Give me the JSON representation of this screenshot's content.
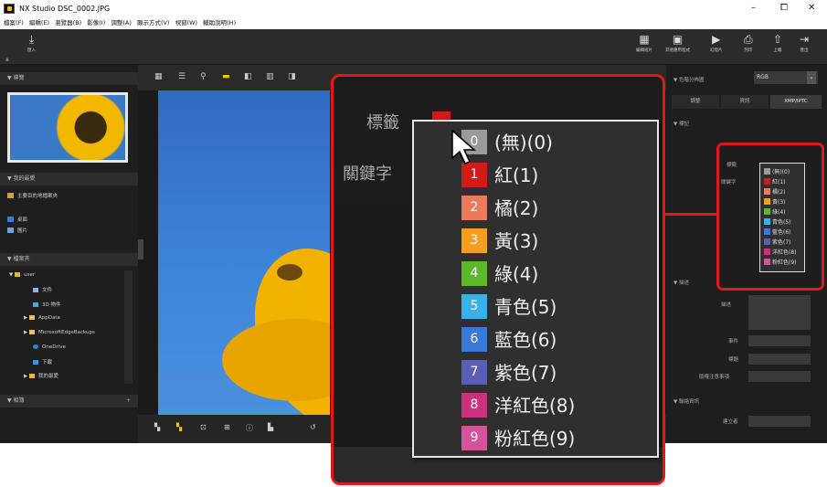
{
  "window": {
    "title": "NX Studio   DSC_0002.JPG",
    "controls": [
      "–",
      "⧠",
      "✕"
    ]
  },
  "menu": [
    "檔案(F)",
    "編輯(E)",
    "瀏覽器(B)",
    "影像(I)",
    "調整(A)",
    "顯示方式(V)",
    "視窗(W)",
    "輔助說明(H)"
  ],
  "toolbar": {
    "import": "匯入",
    "right": [
      {
        "icon": "edit-movie-icon",
        "label": "編輯短片"
      },
      {
        "icon": "other-app-icon",
        "label": "其他應用程式"
      },
      {
        "icon": "slideshow-icon",
        "label": "幻燈片"
      },
      {
        "icon": "print-icon",
        "label": "列印"
      },
      {
        "icon": "upload-icon",
        "label": "上載"
      },
      {
        "icon": "export-icon",
        "label": "匯出"
      }
    ]
  },
  "left": {
    "navigator": "導覽",
    "favorites": "我的最愛",
    "fav_items": [
      "主要目的地檔案夾",
      "桌面",
      "圖片"
    ],
    "folders": "檔案夾",
    "tree": [
      {
        "label": "user",
        "level": 0
      },
      {
        "label": "文件",
        "level": 1
      },
      {
        "label": "3D 物件",
        "level": 1
      },
      {
        "label": "AppData",
        "level": 1
      },
      {
        "label": "MicrosoftEdgeBackups",
        "level": 1
      },
      {
        "label": "OneDrive",
        "level": 1
      },
      {
        "label": "下載",
        "level": 1
      },
      {
        "label": "我的最愛",
        "level": 1
      }
    ],
    "albums": "相簿",
    "albums_add": "+"
  },
  "right": {
    "histogram": "色階分佈圖",
    "histogram_mode": "RGB",
    "tabs": [
      "調整",
      "資訊",
      "XMP/IPTC"
    ],
    "tags_section": "標記",
    "tag_label": "標籤",
    "keyword_label": "關鍵字",
    "desc_section": "描述",
    "desc_label": "描述",
    "event_label": "事件",
    "caption_label": "標題",
    "copyright_label": "版權注意事項",
    "contact_section": "聯絡資訊",
    "creator_label": "建立者"
  },
  "callout": {
    "tag_label": "標籤",
    "tag_value": "1",
    "keyword_label": "關鍵字",
    "options": [
      {
        "num": "0",
        "label": "(無)(0)",
        "color": "#9a9a9a"
      },
      {
        "num": "1",
        "label": "紅(1)",
        "color": "#d11a1a"
      },
      {
        "num": "2",
        "label": "橘(2)",
        "color": "#e97a5b"
      },
      {
        "num": "3",
        "label": "黃(3)",
        "color": "#f0a01e"
      },
      {
        "num": "4",
        "label": "綠(4)",
        "color": "#5cb82a"
      },
      {
        "num": "5",
        "label": "青色(5)",
        "color": "#3ab0e6"
      },
      {
        "num": "6",
        "label": "藍色(6)",
        "color": "#3b79d4"
      },
      {
        "num": "7",
        "label": "紫色(7)",
        "color": "#5b5eb5"
      },
      {
        "num": "8",
        "label": "洋紅色(8)",
        "color": "#c8327e"
      },
      {
        "num": "9",
        "label": "粉紅色(9)",
        "color": "#d3549a"
      }
    ]
  }
}
